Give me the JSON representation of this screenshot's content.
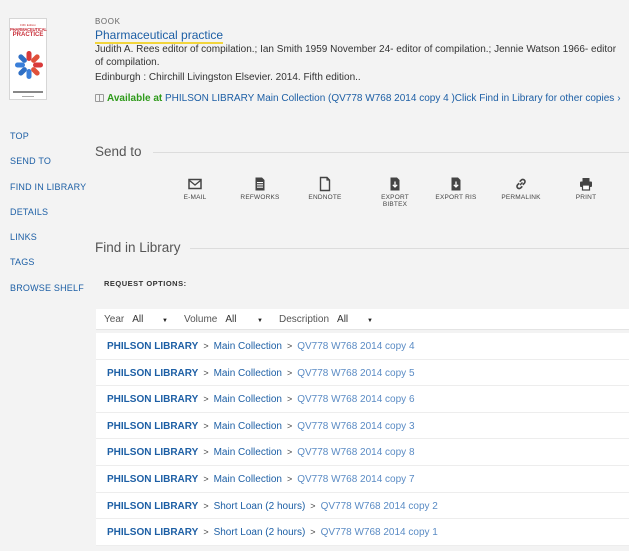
{
  "record": {
    "type": "BOOK",
    "title": "Pharmaceutical practice",
    "authors": "Judith A. Rees editor of compilation.; Ian Smith 1959 November 24- editor of compilation.; Jennie Watson 1966- editor of compilation.",
    "publication": "Edinburgh : Chirchill Livingston Elsevier. 2014. Fifth edition..",
    "availability": {
      "status": "Available at",
      "location": "PHILSON LIBRARY  Main Collection (QV778 W768 2014 copy 4 )Click Find in Library for other copies",
      "chevron": "›"
    },
    "cover": {
      "edition_text": "Fifth Edition",
      "title_line1": "PHARMACEUTICAL",
      "title_line2": "PRACTICE"
    }
  },
  "nav": [
    "TOP",
    "SEND TO",
    "FIND IN LIBRARY",
    "DETAILS",
    "LINKS",
    "TAGS",
    "BROWSE SHELF"
  ],
  "send_to": {
    "heading": "Send to",
    "items": [
      "E-MAIL",
      "REFWORKS",
      "ENDNOTE",
      "EXPORT BIBTEX",
      "EXPORT RIS",
      "PERMALINK",
      "PRINT"
    ]
  },
  "find_in_library": {
    "heading": "Find in Library",
    "request_options": "REQUEST OPTIONS:",
    "filters": {
      "year_label": "Year",
      "year_value": "All",
      "volume_label": "Volume",
      "volume_value": "All",
      "description_label": "Description",
      "description_value": "All"
    },
    "rows": [
      {
        "library": "PHILSON LIBRARY",
        "collection": "Main Collection",
        "call_number": "QV778 W768 2014 copy 4"
      },
      {
        "library": "PHILSON LIBRARY",
        "collection": "Main Collection",
        "call_number": "QV778 W768 2014 copy 5"
      },
      {
        "library": "PHILSON LIBRARY",
        "collection": "Main Collection",
        "call_number": "QV778 W768 2014 copy 6"
      },
      {
        "library": "PHILSON LIBRARY",
        "collection": "Main Collection",
        "call_number": "QV778 W768 2014 copy 3"
      },
      {
        "library": "PHILSON LIBRARY",
        "collection": "Main Collection",
        "call_number": "QV778 W768 2014 copy 8"
      },
      {
        "library": "PHILSON LIBRARY",
        "collection": "Main Collection",
        "call_number": "QV778 W768 2014 copy 7"
      },
      {
        "library": "PHILSON LIBRARY",
        "collection": "Short Loan (2 hours)",
        "call_number": "QV778 W768 2014 copy 2"
      },
      {
        "library": "PHILSON LIBRARY",
        "collection": "Short Loan (2 hours)",
        "call_number": "QV778 W768 2014 copy 1"
      }
    ]
  },
  "colors": {
    "link": "#1d5fa5",
    "available": "#2e9a1a",
    "title_underline": "#f2d53c",
    "background": "#f3f3f3"
  }
}
